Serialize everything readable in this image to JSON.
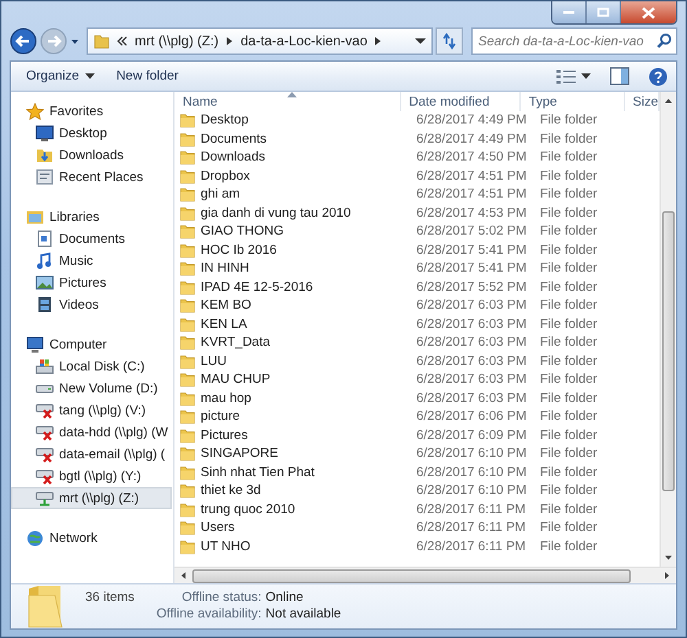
{
  "address": {
    "crumbs": [
      "mrt (\\\\plg) (Z:)",
      "da-ta-a-Loc-kien-vao"
    ]
  },
  "search": {
    "placeholder": "Search da-ta-a-Loc-kien-vao"
  },
  "toolbar": {
    "buttons": [
      {
        "label": "Organize",
        "dropdown": true
      },
      {
        "label": "New folder",
        "dropdown": false
      }
    ]
  },
  "nav": [
    {
      "label": "Favorites",
      "kind": "star",
      "selected": false,
      "children": [
        {
          "label": "Desktop",
          "kind": "desktop",
          "selected": false
        },
        {
          "label": "Downloads",
          "kind": "downloads",
          "selected": false
        },
        {
          "label": "Recent Places",
          "kind": "recent",
          "selected": false
        }
      ]
    },
    {
      "label": "Libraries",
      "kind": "libraries",
      "selected": false,
      "children": [
        {
          "label": "Documents",
          "kind": "documents",
          "selected": false
        },
        {
          "label": "Music",
          "kind": "music",
          "selected": false
        },
        {
          "label": "Pictures",
          "kind": "pictures",
          "selected": false
        },
        {
          "label": "Videos",
          "kind": "videos",
          "selected": false
        }
      ]
    },
    {
      "label": "Computer",
      "kind": "computer",
      "selected": false,
      "children": [
        {
          "label": "Local Disk (C:)",
          "kind": "systemdisk",
          "selected": false
        },
        {
          "label": "New Volume (D:)",
          "kind": "disk",
          "selected": false
        },
        {
          "label": "tang (\\\\plg) (V:)",
          "kind": "netdrive",
          "disconnected": true,
          "selected": false
        },
        {
          "label": "data-hdd (\\\\plg) (W",
          "kind": "netdrive",
          "disconnected": true,
          "selected": false
        },
        {
          "label": "data-email (\\\\plg) (",
          "kind": "netdrive",
          "disconnected": true,
          "selected": false
        },
        {
          "label": "bgtl (\\\\plg) (Y:)",
          "kind": "netdrive",
          "disconnected": true,
          "selected": false
        },
        {
          "label": "mrt (\\\\plg) (Z:)",
          "kind": "netdrive",
          "disconnected": false,
          "selected": true
        }
      ]
    },
    {
      "label": "Network",
      "kind": "network",
      "selected": false
    }
  ],
  "table": {
    "columns": [
      "Name",
      "Date modified",
      "Type",
      "Size"
    ],
    "rows": [
      {
        "name": "Desktop",
        "date": "6/28/2017 4:49 PM",
        "type": "File folder"
      },
      {
        "name": "Documents",
        "date": "6/28/2017 4:49 PM",
        "type": "File folder"
      },
      {
        "name": "Downloads",
        "date": "6/28/2017 4:50 PM",
        "type": "File folder"
      },
      {
        "name": "Dropbox",
        "date": "6/28/2017 4:51 PM",
        "type": "File folder"
      },
      {
        "name": "ghi am",
        "date": "6/28/2017 4:51 PM",
        "type": "File folder"
      },
      {
        "name": "gia danh di vung tau 2010",
        "date": "6/28/2017 4:53 PM",
        "type": "File folder"
      },
      {
        "name": "GIAO THONG",
        "date": "6/28/2017 5:02 PM",
        "type": "File folder"
      },
      {
        "name": "HOC Ib 2016",
        "date": "6/28/2017 5:41 PM",
        "type": "File folder"
      },
      {
        "name": "IN HINH",
        "date": "6/28/2017 5:41 PM",
        "type": "File folder"
      },
      {
        "name": "IPAD 4E 12-5-2016",
        "date": "6/28/2017 5:52 PM",
        "type": "File folder"
      },
      {
        "name": "KEM BO",
        "date": "6/28/2017 6:03 PM",
        "type": "File folder"
      },
      {
        "name": "KEN LA",
        "date": "6/28/2017 6:03 PM",
        "type": "File folder"
      },
      {
        "name": "KVRT_Data",
        "date": "6/28/2017 6:03 PM",
        "type": "File folder"
      },
      {
        "name": "LUU",
        "date": "6/28/2017 6:03 PM",
        "type": "File folder"
      },
      {
        "name": "MAU CHUP",
        "date": "6/28/2017 6:03 PM",
        "type": "File folder"
      },
      {
        "name": "mau hop",
        "date": "6/28/2017 6:03 PM",
        "type": "File folder"
      },
      {
        "name": "picture",
        "date": "6/28/2017 6:06 PM",
        "type": "File folder"
      },
      {
        "name": "Pictures",
        "date": "6/28/2017 6:09 PM",
        "type": "File folder"
      },
      {
        "name": "SINGAPORE",
        "date": "6/28/2017 6:10 PM",
        "type": "File folder"
      },
      {
        "name": "Sinh nhat Tien Phat",
        "date": "6/28/2017 6:10 PM",
        "type": "File folder"
      },
      {
        "name": "thiet ke 3d",
        "date": "6/28/2017 6:10 PM",
        "type": "File folder"
      },
      {
        "name": "trung quoc 2010",
        "date": "6/28/2017 6:11 PM",
        "type": "File folder"
      },
      {
        "name": "Users",
        "date": "6/28/2017 6:11 PM",
        "type": "File folder"
      },
      {
        "name": "UT NHO",
        "date": "6/28/2017 6:11 PM",
        "type": "File folder"
      }
    ]
  },
  "details": {
    "count": "36 items",
    "fields": [
      {
        "label": "Offline status:",
        "value": "Online"
      },
      {
        "label": "Offline availability:",
        "value": "Not available"
      }
    ]
  }
}
